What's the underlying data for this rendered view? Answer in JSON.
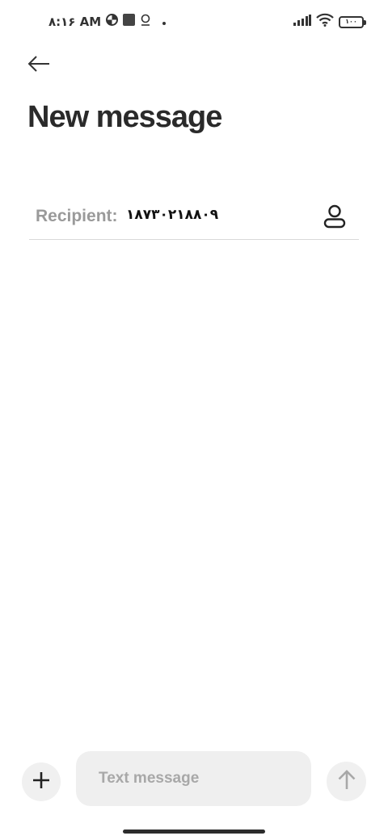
{
  "status_bar": {
    "time": "۸:۱۶ AM",
    "battery_level": "۱۰۰",
    "icons": [
      "data-saver-icon",
      "notification-square-icon",
      "location-pin-icon",
      "dot-icon",
      "cellular-signal-icon",
      "wifi-icon",
      "battery-icon"
    ]
  },
  "header": {
    "back_icon": "arrow-left-icon",
    "title": "New message"
  },
  "recipient": {
    "label": "Recipient:",
    "value": "۱۸۷۳۰۲۱۸۸۰۹",
    "contact_icon": "person-icon"
  },
  "composer": {
    "add_icon": "plus-icon",
    "placeholder": "Text message",
    "send_icon": "arrow-up-icon"
  },
  "colors": {
    "background": "#ffffff",
    "input_bg": "#efefef",
    "muted_text": "#9a9a9a",
    "dark_text": "#2a2a2a"
  }
}
